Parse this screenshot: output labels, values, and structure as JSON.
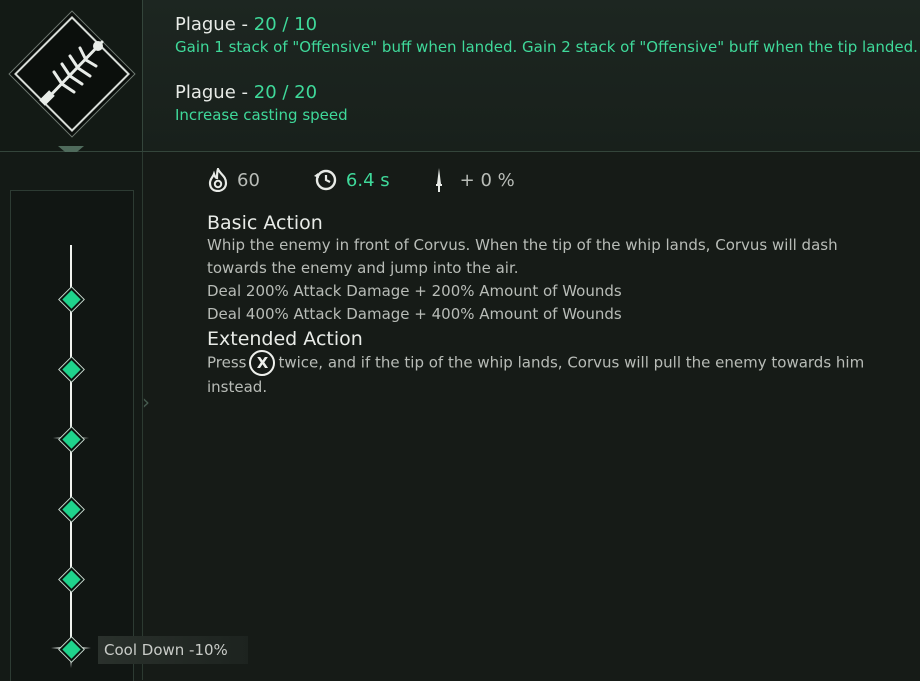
{
  "skill": {
    "icon": "whip-icon",
    "traits": [
      {
        "name": "Plague",
        "separator": " - ",
        "level": "20 / 10",
        "desc": "Gain 1 stack of \"Offensive\" buff when landed. Gain 2 stack of \"Offensive\" buff when the tip landed."
      },
      {
        "name": "Plague",
        "separator": " - ",
        "level": "20 / 20",
        "desc": "Increase casting speed"
      }
    ],
    "stats": {
      "flame_icon": "flame-icon",
      "flame_value": "60",
      "cooldown_icon": "cooldown-clock-icon",
      "cooldown_value": "6.4 s",
      "dagger_icon": "dagger-icon",
      "dagger_value": "+ 0 %"
    },
    "basic_action": {
      "title": "Basic Action",
      "desc": "Whip the enemy in front of Corvus. When the tip of the whip lands, Corvus will dash towards the enemy and jump into the air.",
      "line2": "Deal 200% Attack Damage + 200% Amount of Wounds",
      "line3": "Deal 400% Attack Damage + 400% Amount of Wounds"
    },
    "extended_action": {
      "title": "Extended Action",
      "pre": "Press",
      "button": "X",
      "post": "twice, and if the tip of the whip lands, Corvus will pull the enemy towards him instead."
    }
  },
  "skill_tree": {
    "cooldown_label": "Cool Down -10%"
  },
  "colors": {
    "accent_green": "#3fd99a",
    "node_green": "#1fd38c",
    "panel_bg": "#161b17"
  }
}
